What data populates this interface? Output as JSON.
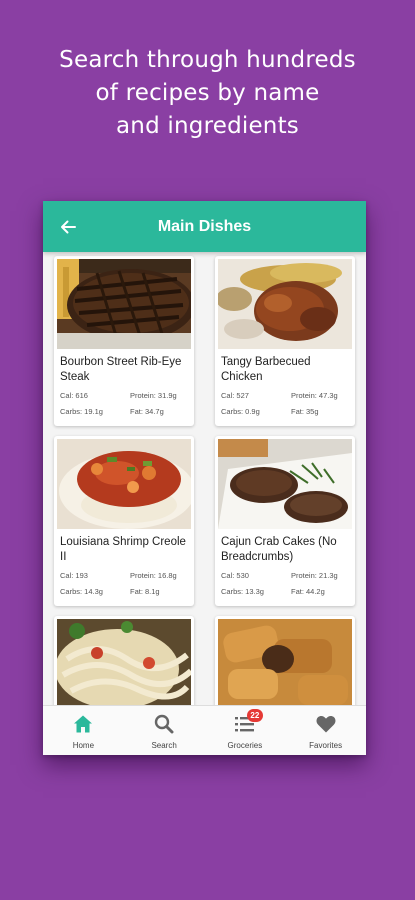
{
  "promo": {
    "lines": [
      "Search through hundreds",
      "of recipes by name",
      "and ingredients"
    ]
  },
  "appbar": {
    "title": "Main Dishes",
    "back_icon": "arrow-left-icon"
  },
  "recipes": [
    {
      "title": "Bourbon Street Rib-Eye Steak",
      "cal": "Cal: 616",
      "protein": "Protein: 31.9g",
      "carbs": "Carbs: 19.1g",
      "fat": "Fat: 34.7g"
    },
    {
      "title": "Tangy Barbecued Chicken",
      "cal": "Cal: 527",
      "protein": "Protein: 47.3g",
      "carbs": "Carbs: 0.9g",
      "fat": "Fat: 35g"
    },
    {
      "title": "Louisiana Shrimp Creole II",
      "cal": "Cal: 193",
      "protein": "Protein: 16.8g",
      "carbs": "Carbs: 14.3g",
      "fat": "Fat: 8.1g"
    },
    {
      "title": "Cajun Crab Cakes (No Breadcrumbs)",
      "cal": "Cal: 530",
      "protein": "Protein: 21.3g",
      "carbs": "Carbs: 13.3g",
      "fat": "Fat: 44.2g"
    },
    {
      "title": "",
      "cal": "",
      "protein": "",
      "carbs": "",
      "fat": ""
    },
    {
      "title": "",
      "cal": "",
      "protein": "",
      "carbs": "",
      "fat": ""
    }
  ],
  "nav": {
    "items": [
      {
        "label": "Home",
        "icon": "home-icon",
        "active": true
      },
      {
        "label": "Search",
        "icon": "search-icon",
        "active": false
      },
      {
        "label": "Groceries",
        "icon": "list-icon",
        "active": false,
        "badge": "22"
      },
      {
        "label": "Favorites",
        "icon": "heart-icon",
        "active": false
      }
    ]
  },
  "colors": {
    "background": "#8a3fa3",
    "appbar": "#2bb89b",
    "accent_active": "#2bb89b",
    "inactive_icon": "#666666",
    "badge": "#e53935"
  }
}
